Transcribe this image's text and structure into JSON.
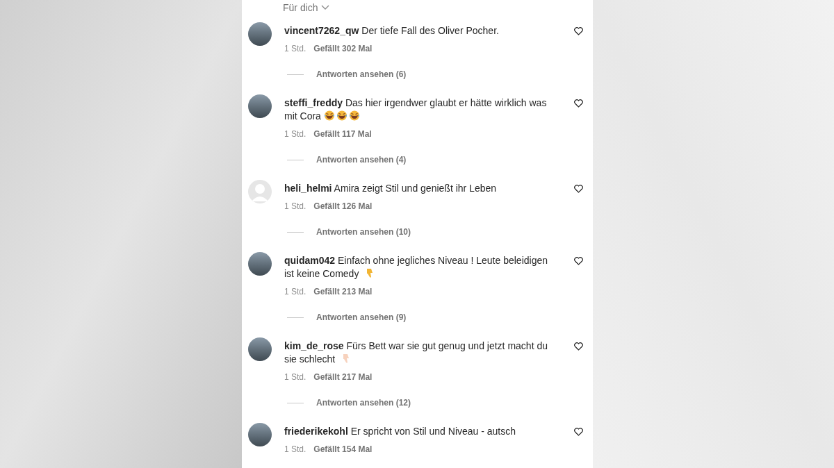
{
  "sort_menu": {
    "label": "Für dich"
  },
  "comments": [
    {
      "avatar": {
        "kind": "photo"
      },
      "username": "vincent7262_qw",
      "text": "Der tiefe Fall des Oliver Pocher.",
      "time": "1 Std.",
      "likes": "Gefällt 302 Mal",
      "replies": "Antworten ansehen (6)"
    },
    {
      "avatar": {
        "kind": "photo"
      },
      "username": "steffi_freddy",
      "text": "Das hier irgendwer glaubt er hätte wirklich was mit Cora",
      "emoji": [
        {
          "kind": "laughing"
        },
        {
          "kind": "laughing"
        },
        {
          "kind": "laughing"
        }
      ],
      "time": "1 Std.",
      "likes": "Gefällt 117 Mal",
      "replies": "Antworten ansehen (4)"
    },
    {
      "avatar": {
        "kind": "default"
      },
      "username": "heli_helmi",
      "text": "Amira zeigt Stil und genießt ihr Leben",
      "time": "1 Std.",
      "likes": "Gefällt 126 Mal",
      "replies": "Antworten ansehen (10)"
    },
    {
      "avatar": {
        "kind": "photo"
      },
      "username": "quidam042",
      "text": "Einfach ohne jegliches Niveau ! Leute beleidigen ist keine Comedy",
      "emoji": [
        {
          "kind": "thumbs-down-yellow"
        }
      ],
      "time": "1 Std.",
      "likes": "Gefällt 213 Mal",
      "replies": "Antworten ansehen (9)"
    },
    {
      "avatar": {
        "kind": "photo"
      },
      "username": "kim_de_rose",
      "text": "Fürs Bett war sie gut genug und jetzt macht du sie schlecht",
      "emoji": [
        {
          "kind": "thumbs-down-light"
        }
      ],
      "time": "1 Std.",
      "likes": "Gefällt 217 Mal",
      "replies": "Antworten ansehen (12)"
    },
    {
      "avatar": {
        "kind": "photo"
      },
      "username": "friederikekohl",
      "text": "Er spricht von Stil und Niveau - autsch",
      "time": "1 Std.",
      "likes": "Gefällt 154 Mal"
    }
  ]
}
